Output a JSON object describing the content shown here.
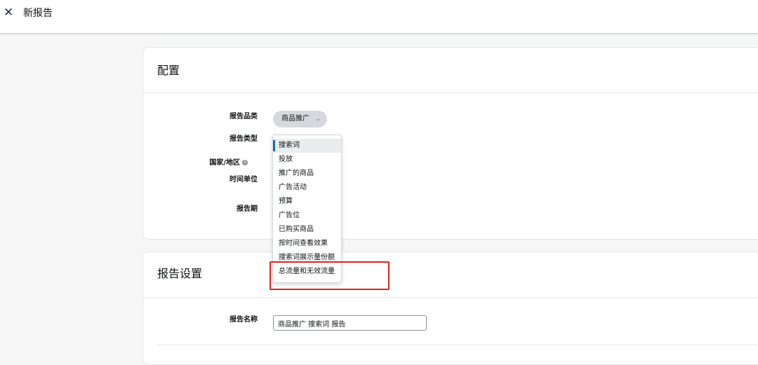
{
  "header": {
    "close_icon": "close-icon",
    "title": "新报告"
  },
  "config": {
    "title": "配置",
    "fields": {
      "category_label": "报告品类",
      "type_label": "报告类型",
      "country_label": "国家/地区",
      "time_unit_label": "时间单位",
      "period_label": "报告期"
    },
    "category_value": "商品推广",
    "info_icon": "i"
  },
  "report_type_dropdown": {
    "options": [
      "搜索词",
      "投放",
      "推广的商品",
      "广告活动",
      "预算",
      "广告位",
      "已购买商品",
      "按时间查看效果",
      "搜索词展示量份额",
      "总流量和无效流量"
    ],
    "selected": "搜索词",
    "highlighted": "总流量和无效流量"
  },
  "settings": {
    "title": "报告设置",
    "name_label": "报告名称",
    "name_value": "商品推广 搜索词 报告"
  },
  "colors": {
    "highlight": "#e02020",
    "accent": "#146eb4"
  }
}
